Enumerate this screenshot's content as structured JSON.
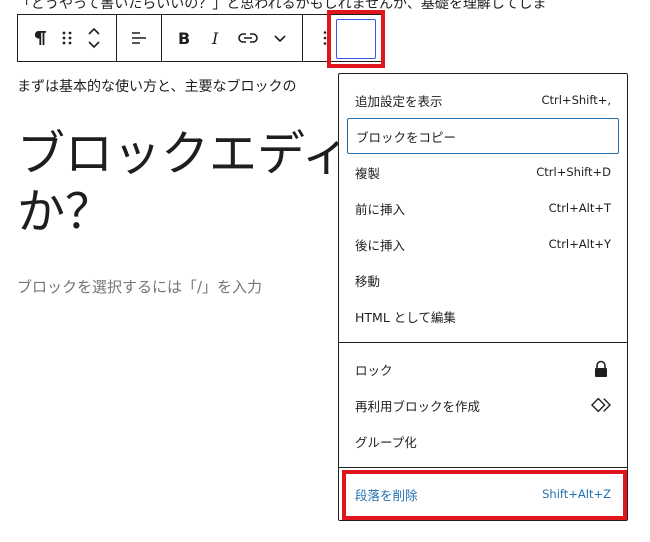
{
  "document": {
    "top_text": "「どうやって書いたらいいの？」と思われるかもしれませんが、基礎を理解してしま",
    "paragraph_text": "まずは基本的な使い方と、主要なブロックの",
    "heading_text": "ブロックエディ\nか？",
    "placeholder": "ブロックを選択するには「/」を入力"
  },
  "toolbar": {
    "paragraph_icon": "pilcrow-icon",
    "drag_icon": "drag-handle-icon",
    "move_icon": "chevron-up-down-icon",
    "align_icon": "align-left-icon",
    "bold_icon": "bold-icon",
    "italic_icon": "italic-icon",
    "link_icon": "link-icon",
    "more_formats_icon": "chevron-down-icon",
    "options_icon": "more-vertical-icon"
  },
  "menu": {
    "group1": [
      {
        "label": "追加設定を表示",
        "shortcut": "Ctrl+Shift+,"
      },
      {
        "label": "ブロックをコピー",
        "shortcut": ""
      },
      {
        "label": "複製",
        "shortcut": "Ctrl+Shift+D"
      },
      {
        "label": "前に挿入",
        "shortcut": "Ctrl+Alt+T"
      },
      {
        "label": "後に挿入",
        "shortcut": "Ctrl+Alt+Y"
      },
      {
        "label": "移動",
        "shortcut": ""
      },
      {
        "label": "HTML として編集",
        "shortcut": ""
      }
    ],
    "group2": [
      {
        "label": "ロック",
        "icon": "lock-icon"
      },
      {
        "label": "再利用ブロックを作成",
        "icon": "reusable-block-icon"
      },
      {
        "label": "グループ化",
        "icon": ""
      }
    ],
    "group3": [
      {
        "label": "段落を削除",
        "shortcut": "Shift+Alt+Z"
      }
    ]
  },
  "colors": {
    "highlight": "#e0161d",
    "danger_text": "#2271b1",
    "focus": "#3858e9"
  }
}
